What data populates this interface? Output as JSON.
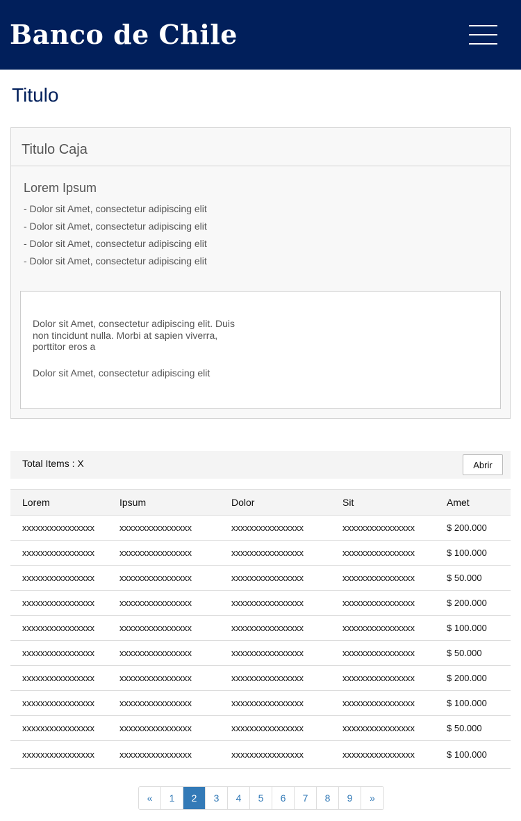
{
  "header": {
    "logo": "Banco de Chile",
    "menu_icon": "hamburger-menu-icon"
  },
  "page_title": "Titulo",
  "box": {
    "title": "Titulo Caja",
    "subtitle": "Lorem Ipsum",
    "bullets": [
      "- Dolor sit Amet, consectetur adipiscing elit",
      "- Dolor sit Amet, consectetur adipiscing elit",
      "- Dolor sit Amet, consectetur adipiscing elit",
      "- Dolor sit Amet, consectetur adipiscing elit"
    ],
    "paragraph1": "Dolor sit Amet, consectetur adipiscing elit. Duis non tincidunt nulla.    Morbi at sapien viverra, porttitor eros a",
    "paragraph2": "Dolor sit Amet, consectetur adipiscing elit"
  },
  "table": {
    "total_label": "Total Items : X",
    "open_button": "Abrir",
    "columns": [
      "Lorem",
      "Ipsum",
      "Dolor",
      "Sit",
      "Amet"
    ],
    "rows": [
      [
        "xxxxxxxxxxxxxxxx",
        "xxxxxxxxxxxxxxxx",
        "xxxxxxxxxxxxxxxx",
        "xxxxxxxxxxxxxxxx",
        "$ 200.000"
      ],
      [
        "xxxxxxxxxxxxxxxx",
        "xxxxxxxxxxxxxxxx",
        "xxxxxxxxxxxxxxxx",
        "xxxxxxxxxxxxxxxx",
        "$ 100.000"
      ],
      [
        "xxxxxxxxxxxxxxxx",
        "xxxxxxxxxxxxxxxx",
        "xxxxxxxxxxxxxxxx",
        "xxxxxxxxxxxxxxxx",
        "$ 50.000"
      ],
      [
        "xxxxxxxxxxxxxxxx",
        "xxxxxxxxxxxxxxxx",
        "xxxxxxxxxxxxxxxx",
        "xxxxxxxxxxxxxxxx",
        "$ 200.000"
      ],
      [
        "xxxxxxxxxxxxxxxx",
        "xxxxxxxxxxxxxxxx",
        "xxxxxxxxxxxxxxxx",
        "xxxxxxxxxxxxxxxx",
        "$ 100.000"
      ],
      [
        "xxxxxxxxxxxxxxxx",
        "xxxxxxxxxxxxxxxx",
        "xxxxxxxxxxxxxxxx",
        "xxxxxxxxxxxxxxxx",
        "$ 50.000"
      ],
      [
        "xxxxxxxxxxxxxxxx",
        "xxxxxxxxxxxxxxxx",
        "xxxxxxxxxxxxxxxx",
        "xxxxxxxxxxxxxxxx",
        "$ 200.000"
      ],
      [
        "xxxxxxxxxxxxxxxx",
        "xxxxxxxxxxxxxxxx",
        "xxxxxxxxxxxxxxxx",
        "xxxxxxxxxxxxxxxx",
        "$ 100.000"
      ],
      [
        "xxxxxxxxxxxxxxxx",
        "xxxxxxxxxxxxxxxx",
        "xxxxxxxxxxxxxxxx",
        "xxxxxxxxxxxxxxxx",
        "$ 50.000"
      ],
      [
        "xxxxxxxxxxxxxxxx",
        "xxxxxxxxxxxxxxxx",
        "xxxxxxxxxxxxxxxx",
        "xxxxxxxxxxxxxxxx",
        "$ 100.000"
      ]
    ]
  },
  "pagination": {
    "prev": "«",
    "pages": [
      "1",
      "2",
      "3",
      "4",
      "5",
      "6",
      "7",
      "8",
      "9"
    ],
    "next": "»",
    "current": "2",
    "accent_color": "#337ab7"
  },
  "colors": {
    "header_bg": "#011f5b",
    "title": "#011f5b"
  }
}
